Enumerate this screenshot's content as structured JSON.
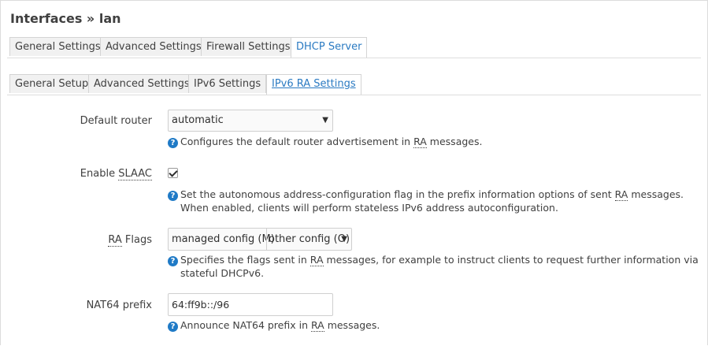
{
  "page": {
    "title": "Interfaces » lan"
  },
  "tabs": [
    {
      "label": "General Settings",
      "active": false
    },
    {
      "label": "Advanced Settings",
      "active": false
    },
    {
      "label": "Firewall Settings",
      "active": false
    },
    {
      "label": "DHCP Server",
      "active": true
    }
  ],
  "subtabs": [
    {
      "label": "General Setup",
      "active": false
    },
    {
      "label": "Advanced Settings",
      "active": false
    },
    {
      "label": "IPv6 Settings",
      "active": false
    },
    {
      "label": "IPv6 RA Settings",
      "active": true
    }
  ],
  "fields": {
    "default_router": {
      "label": "Default router",
      "value": "automatic",
      "help_pre": "Configures the default router advertisement in ",
      "help_abbr": "RA",
      "help_post": " messages."
    },
    "slaac": {
      "label_pre": "Enable ",
      "label_abbr": "SLAAC",
      "checked": true,
      "help_pre": "Set the autonomous address-configuration flag in the prefix information options of sent ",
      "help_abbr": "RA",
      "help_post": " messages. When enabled, clients will perform stateless IPv6 address autoconfiguration."
    },
    "ra_flags": {
      "label_abbr": "RA",
      "label_post": " Flags",
      "selected": [
        "managed config (M)",
        "other config (O)"
      ],
      "help_pre": "Specifies the flags sent in ",
      "help_abbr": "RA",
      "help_post": " messages, for example to instruct clients to request further information via stateful DHCPv6."
    },
    "nat64": {
      "label": "NAT64 prefix",
      "value": "64:ff9b::/96",
      "help_pre": "Announce NAT64 prefix in ",
      "help_abbr": "RA",
      "help_post": " messages."
    }
  },
  "icons": {
    "help": "help-circle-icon",
    "dropdown": "chevron-down-icon",
    "check": "checkmark-icon"
  },
  "colors": {
    "accent": "#2a7ac2",
    "help_icon": "#1f7ac6",
    "tab_bg": "#f1f1f1"
  }
}
